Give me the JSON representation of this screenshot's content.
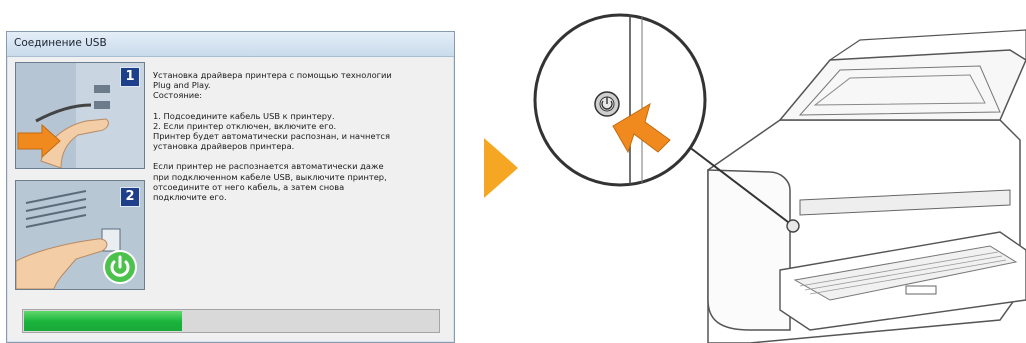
{
  "dialog": {
    "title": "Соединение USB",
    "step1_number": "1",
    "step2_number": "2",
    "text": {
      "line1": "Установка драйвера принтера с помощью технологии",
      "line2": "Plug and Play.",
      "line3": "Состояние:",
      "item1": "1. Подсоедините кабель USB к принтеру.",
      "item2": "2. Если принтер отключен, включите его.",
      "item2b": "Принтер будет автоматически распознан, и начнется",
      "item2c": "установка драйверов принтера.",
      "note1": "Если принтер не распознается автоматически даже",
      "note2": "при подключенном кабеле USB, выключите принтер,",
      "note3": "отсоедините от него кабель, а затем снова",
      "note4": "подключите его."
    },
    "progress": 0.38
  },
  "colors": {
    "step_number_bg": "#1e3f8a",
    "progress_green": "#19b33a",
    "arrow_orange": "#f5a623",
    "power_green": "#4cc24c"
  },
  "icons": [
    "usb-plug-icon",
    "power-icon",
    "next-arrow-icon",
    "power-button-icon"
  ]
}
